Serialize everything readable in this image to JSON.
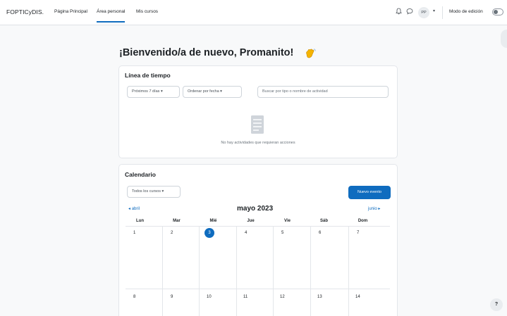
{
  "navbar": {
    "brand": "FOPTICyDIS.",
    "links": [
      {
        "label": "Página Principal",
        "active": false
      },
      {
        "label": "Área personal",
        "active": true
      },
      {
        "label": "Mis cursos",
        "active": false
      }
    ],
    "notifications_icon": "bell-icon",
    "messages_icon": "chat-bubble-icon",
    "user_initials": "PP",
    "edit_mode_label": "Modo de edición",
    "edit_mode_on": false
  },
  "page": {
    "welcome": "¡Bienvenido/a de nuevo, Promanito!",
    "welcome_icon": "waving-hand-icon"
  },
  "timeline": {
    "title": "Línea de tiempo",
    "day_filter": "Próximos 7 días",
    "sort_filter": "Ordenar por fecha",
    "search_placeholder": "Buscar por tipo o nombre de actividad",
    "empty_message": "No hay actividades que requieran acciones"
  },
  "calendar": {
    "title": "Calendario",
    "course_filter": "Todos los cursos",
    "new_event": "Nuevo evento",
    "prev_month": "abril",
    "next_month": "junio",
    "month_title": "mayo 2023",
    "weekdays": [
      "Lun",
      "Mar",
      "Mié",
      "Jue",
      "Vie",
      "Sáb",
      "Dom"
    ],
    "week1": [
      "1",
      "2",
      "3",
      "4",
      "5",
      "6",
      "7"
    ],
    "week2": [
      "8",
      "9",
      "10",
      "11",
      "12",
      "13",
      "14"
    ],
    "today": "3"
  },
  "help_label": "?",
  "colors": {
    "accent": "#0f6cbf",
    "background": "#f8f9fa"
  }
}
